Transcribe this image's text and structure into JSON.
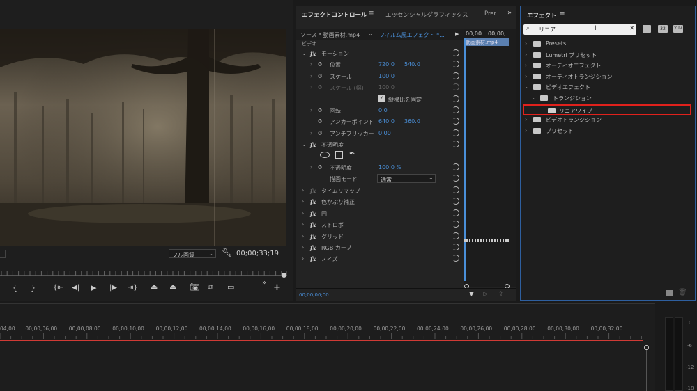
{
  "monitor": {
    "fit_label": "フル画質",
    "timecode": "00;00;33;19",
    "transport_icons": [
      "mark-in-icon",
      "mark-out-icon",
      "go-to-in-icon",
      "step-back-icon",
      "play-icon",
      "step-forward-icon",
      "go-to-out-icon",
      "lift-icon",
      "extract-icon",
      "export-frame-icon",
      "compare-icon",
      "safe-margins-icon",
      "add-button-icon"
    ]
  },
  "effect_controls": {
    "tabs": [
      "エフェクトコントロール",
      "エッセンシャルグラフィックス",
      "Prer"
    ],
    "source_label": "ソース * 動画素材.mp4",
    "clip_label": "フィルム風エフェクト *...",
    "section_label": "ビデオ",
    "mini_timeline_timecodes": [
      "00;00",
      "00;00;"
    ],
    "mini_clip_label": "動画素材.mp4",
    "bottom_timecode": "00;00;00;00",
    "motion": {
      "title": "モーション",
      "position_label": "位置",
      "position_x": "720.0",
      "position_y": "540.0",
      "scale_label": "スケール",
      "scale_value": "100.0",
      "scale_width_label": "スケール (幅)",
      "scale_width_value": "100.0",
      "uniform_scale_label": "縦横比を固定",
      "rotation_label": "回転",
      "rotation_value": "0.0",
      "anchor_label": "アンカーポイント",
      "anchor_x": "640.0",
      "anchor_y": "360.0",
      "antiflicker_label": "アンチフリッカー",
      "antiflicker_value": "0.00"
    },
    "opacity": {
      "title": "不透明度",
      "opacity_label": "不透明度",
      "opacity_value": "100.0 %",
      "blend_label": "描画モード",
      "blend_value": "通常"
    },
    "other_effects": [
      "タイムリマップ",
      "色かぶり補正",
      "円",
      "ストロボ",
      "グリッド",
      "RGB カーブ",
      "ノイズ"
    ]
  },
  "effects_panel": {
    "title": "エフェクト",
    "search_value": "リニア",
    "badge_labels": [
      "32",
      "YUV"
    ],
    "tree": [
      {
        "label": "Presets",
        "depth": 0,
        "expanded": false
      },
      {
        "label": "Lumetri プリセット",
        "depth": 0,
        "expanded": false
      },
      {
        "label": "オーディオエフェクト",
        "depth": 0,
        "expanded": false
      },
      {
        "label": "オーディオトランジション",
        "depth": 0,
        "expanded": false
      },
      {
        "label": "ビデオエフェクト",
        "depth": 0,
        "expanded": true
      },
      {
        "label": "トランジション",
        "depth": 1,
        "expanded": true
      },
      {
        "label": "リニアワイプ",
        "depth": 2,
        "highlighted": true
      },
      {
        "label": "ビデオトランジション",
        "depth": 0,
        "expanded": false
      },
      {
        "label": "プリセット",
        "depth": 0,
        "expanded": false
      }
    ],
    "highlight_color": "#e0211c"
  },
  "timeline": {
    "ruler": [
      "04;00",
      "00;00;06;00",
      "00;00;08;00",
      "00;00;10;00",
      "00;00;12;00",
      "00;00;14;00",
      "00;00;16;00",
      "00;00;18;00",
      "00;00;20;00",
      "00;00;22;00",
      "00;00;24;00",
      "00;00;26;00",
      "00;00;28;00",
      "00;00;30;00",
      "00;00;32;00"
    ],
    "playhead_color": "#d03a35"
  },
  "meters": {
    "scale": [
      "0",
      "-6",
      "-12",
      "-18"
    ]
  },
  "colors": {
    "accent_blue": "#4a8fd8",
    "panel_border": "#2e5f9f"
  }
}
